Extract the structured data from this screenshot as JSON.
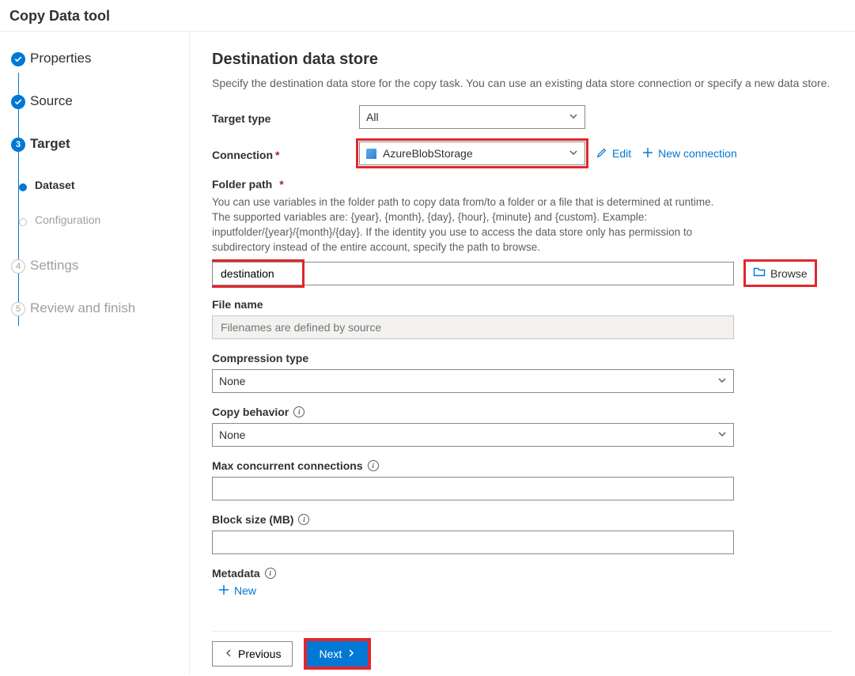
{
  "page": {
    "title": "Copy Data tool"
  },
  "sidebar": {
    "items": [
      {
        "label": "Properties",
        "state": "done"
      },
      {
        "label": "Source",
        "state": "done"
      },
      {
        "label": "Target",
        "state": "current"
      },
      {
        "label": "Dataset",
        "state": "current-sub"
      },
      {
        "label": "Configuration",
        "state": "pending-sub"
      },
      {
        "label": "Settings",
        "state": "pending",
        "num": "4"
      },
      {
        "label": "Review and finish",
        "state": "pending",
        "num": "5"
      }
    ],
    "current_num": "3"
  },
  "main": {
    "title": "Destination data store",
    "description": "Specify the destination data store for the copy task. You can use an existing data store connection or specify a new data store.",
    "target_type": {
      "label": "Target type",
      "value": "All"
    },
    "connection": {
      "label": "Connection",
      "value": "AzureBlobStorage",
      "edit": "Edit",
      "new": "New connection"
    },
    "folder_path": {
      "label": "Folder path",
      "help": "You can use variables in the folder path to copy data from/to a folder or a file that is determined at runtime. The supported variables are: {year}, {month}, {day}, {hour}, {minute} and {custom}. Example: inputfolder/{year}/{month}/{day}. If the identity you use to access the data store only has permission to subdirectory instead of the entire account, specify the path to browse.",
      "value": "destination",
      "browse": "Browse"
    },
    "file_name": {
      "label": "File name",
      "placeholder": "Filenames are defined by source"
    },
    "compression": {
      "label": "Compression type",
      "value": "None"
    },
    "copy_behavior": {
      "label": "Copy behavior",
      "value": "None"
    },
    "max_conn": {
      "label": "Max concurrent connections",
      "value": ""
    },
    "block_size": {
      "label": "Block size (MB)",
      "value": ""
    },
    "metadata": {
      "label": "Metadata",
      "new": "New"
    }
  },
  "footer": {
    "previous": "Previous",
    "next": "Next"
  }
}
